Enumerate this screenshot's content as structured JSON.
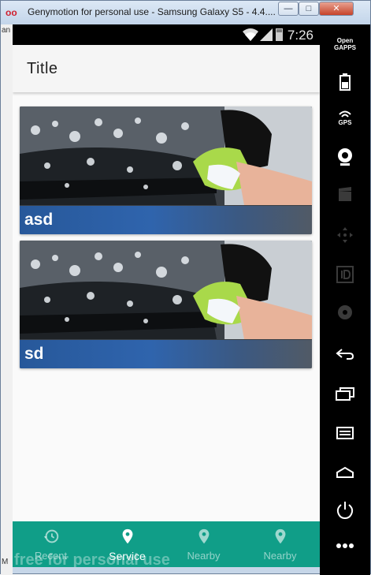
{
  "window": {
    "title": "Genymotion for personal use - Samsung Galaxy S5 - 4.4....",
    "minimize_label": "—",
    "maximize_label": "□",
    "close_label": "✕"
  },
  "host_strip": {
    "top_text": "an",
    "bottom_text": "M"
  },
  "status_bar": {
    "time": "7:26"
  },
  "app_bar": {
    "title": "Title"
  },
  "cards": [
    {
      "label": "asd",
      "image": "car-wash-photo"
    },
    {
      "label": "sd",
      "image": "car-wash-photo"
    }
  ],
  "bottom_nav": {
    "items": [
      {
        "label": "Recent",
        "icon": "history-icon",
        "active": false
      },
      {
        "label": "Service",
        "icon": "location-pin-icon",
        "active": true
      },
      {
        "label": "Nearby",
        "icon": "location-pin-icon",
        "active": false
      },
      {
        "label": "Nearby",
        "icon": "location-pin-icon",
        "active": false
      }
    ],
    "accent_color": "#109e88"
  },
  "watermark": "free for personal use",
  "toolbar": {
    "gapps_label_1": "Open",
    "gapps_label_2": "GAPPS",
    "gps_label": "GPS",
    "items": [
      "open-gapps-icon",
      "battery-icon",
      "gps-icon",
      "webcam-icon",
      "screencast-icon",
      "dpad-icon",
      "id-icon",
      "disk-icon",
      "back-icon",
      "recent-apps-icon",
      "menu-icon",
      "home-icon",
      "power-icon",
      "more-icon"
    ]
  }
}
